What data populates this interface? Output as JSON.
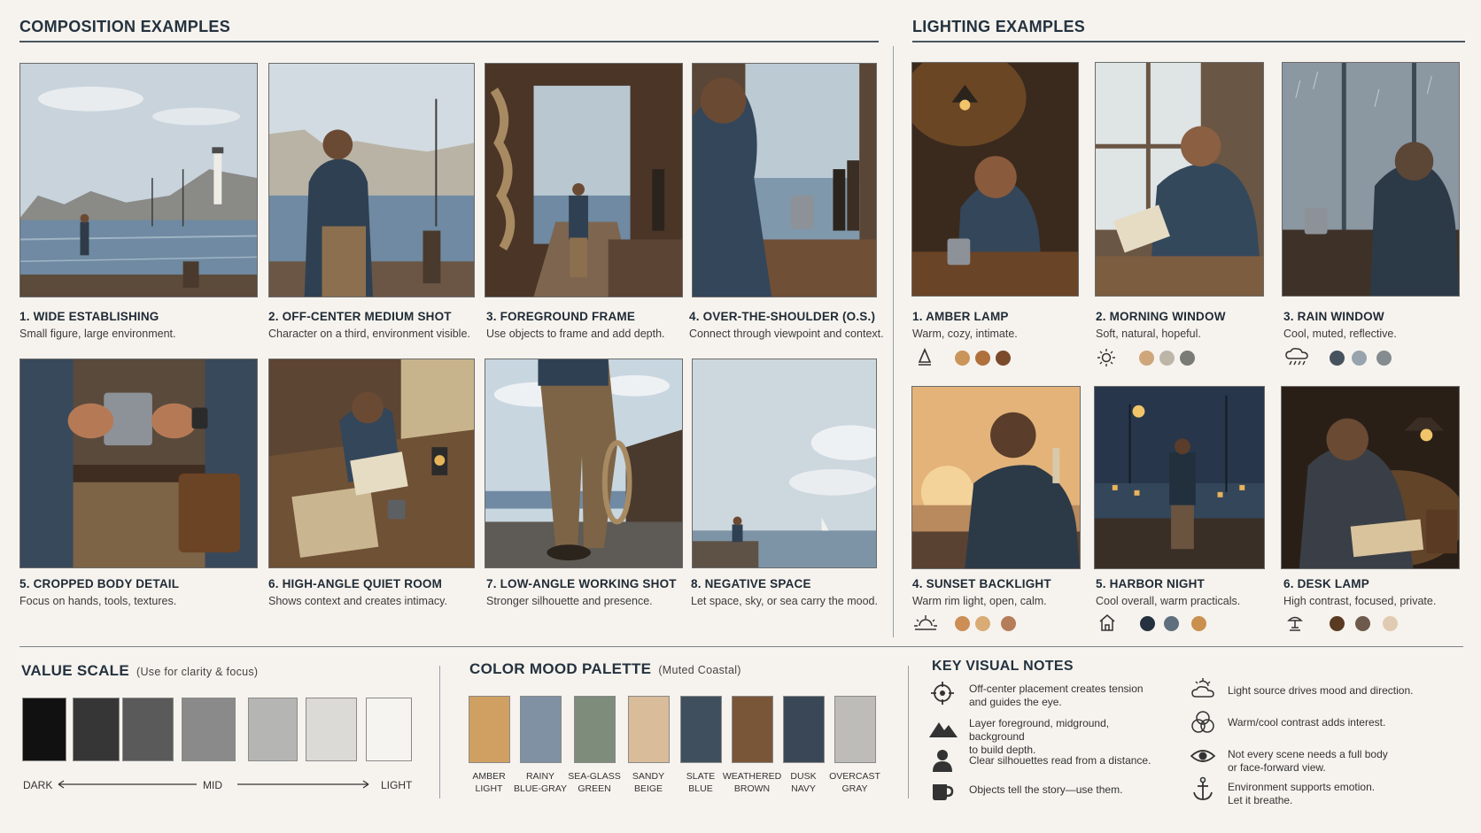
{
  "composition": {
    "title": "COMPOSITION EXAMPLES",
    "items": [
      {
        "title": "1. WIDE ESTABLISHING",
        "desc": "Small figure, large environment."
      },
      {
        "title": "2. OFF-CENTER MEDIUM SHOT",
        "desc": "Character on a third, environment visible."
      },
      {
        "title": "3. FOREGROUND FRAME",
        "desc": "Use objects to frame and add depth."
      },
      {
        "title": "4. OVER-THE-SHOULDER (O.S.)",
        "desc": "Connect through viewpoint and context."
      },
      {
        "title": "5. CROPPED BODY DETAIL",
        "desc": "Focus on hands, tools, textures."
      },
      {
        "title": "6. HIGH-ANGLE QUIET ROOM",
        "desc": "Shows context and creates intimacy."
      },
      {
        "title": "7. LOW-ANGLE WORKING SHOT",
        "desc": "Stronger silhouette and presence."
      },
      {
        "title": "8. NEGATIVE SPACE",
        "desc": "Let space, sky, or sea carry the mood."
      }
    ]
  },
  "lighting": {
    "title": "LIGHTING EXAMPLES",
    "items": [
      {
        "title": "1. AMBER LAMP",
        "desc": "Warm, cozy, intimate.",
        "icon": "lamp-icon",
        "swatches": [
          "#c9955b",
          "#b0703c",
          "#7b4a2b"
        ]
      },
      {
        "title": "2. MORNING WINDOW",
        "desc": "Soft, natural, hopeful.",
        "icon": "sun-icon",
        "swatches": [
          "#cfa67a",
          "#bdb6a8",
          "#7a7a76"
        ]
      },
      {
        "title": "3. RAIN WINDOW",
        "desc": "Cool, muted, reflective.",
        "icon": "rain-cloud-icon",
        "swatches": [
          "#46525e",
          "#97a3ad",
          "#858c8f"
        ]
      },
      {
        "title": "4. SUNSET BACKLIGHT",
        "desc": "Warm rim light, open, calm.",
        "icon": "sunset-icon",
        "swatches": [
          "#cc8e55",
          "#d8ac74",
          "#b57d5a"
        ]
      },
      {
        "title": "5. HARBOR NIGHT",
        "desc": "Cool overall, warm practicals.",
        "icon": "house-light-icon",
        "swatches": [
          "#25313e",
          "#5f6f7e",
          "#c9904f"
        ]
      },
      {
        "title": "6. DESK LAMP",
        "desc": "High contrast, focused, private.",
        "icon": "desk-lamp-icon",
        "swatches": [
          "#5b3a22",
          "#6e5a4c",
          "#e0cbb2"
        ]
      }
    ]
  },
  "value_scale": {
    "title": "VALUE SCALE",
    "subtitle": "(Use for clarity & focus)",
    "swatches": [
      "#111111",
      "#363636",
      "#5a5a5a",
      "#8a8a8a",
      "#b5b5b3",
      "#dcdad6",
      "#f5f4f1"
    ],
    "dark_label": "DARK",
    "mid_label": "MID",
    "light_label": "LIGHT"
  },
  "color_mood": {
    "title": "COLOR MOOD PALETTE",
    "subtitle": "(Muted Coastal)",
    "swatches": [
      {
        "color": "#d0a062",
        "line1": "AMBER",
        "line2": "LIGHT"
      },
      {
        "color": "#7f91a3",
        "line1": "RAINY",
        "line2": "BLUE-GRAY"
      },
      {
        "color": "#7e8c7c",
        "line1": "SEA-GLASS",
        "line2": "GREEN"
      },
      {
        "color": "#d9bc99",
        "line1": "SANDY",
        "line2": "BEIGE"
      },
      {
        "color": "#3f4f5d",
        "line1": "SLATE",
        "line2": "BLUE"
      },
      {
        "color": "#7a5638",
        "line1": "WEATHERED",
        "line2": "BROWN"
      },
      {
        "color": "#3a4756",
        "line1": "DUSK",
        "line2": "NAVY"
      },
      {
        "color": "#bdbcb9",
        "line1": "OVERCAST",
        "line2": "GRAY"
      }
    ]
  },
  "notes": {
    "title": "KEY VISUAL NOTES",
    "left": [
      {
        "icon": "crosshair-icon",
        "text": "Off-center placement creates tension\nand guides the eye."
      },
      {
        "icon": "mountains-icon",
        "text": "Layer foreground, midground, background\nto build depth."
      },
      {
        "icon": "person-silhouette-icon",
        "text": "Clear silhouettes read from a distance."
      },
      {
        "icon": "mug-icon",
        "text": "Objects tell the story—use them."
      }
    ],
    "right": [
      {
        "icon": "sun-cloud-icon",
        "text": "Light source drives mood and direction."
      },
      {
        "icon": "color-circles-icon",
        "text": "Warm/cool contrast adds interest."
      },
      {
        "icon": "eye-icon",
        "text": "Not every scene needs a full body\nor face-forward view."
      },
      {
        "icon": "anchor-icon",
        "text": "Environment supports emotion.\nLet it breathe."
      }
    ]
  }
}
